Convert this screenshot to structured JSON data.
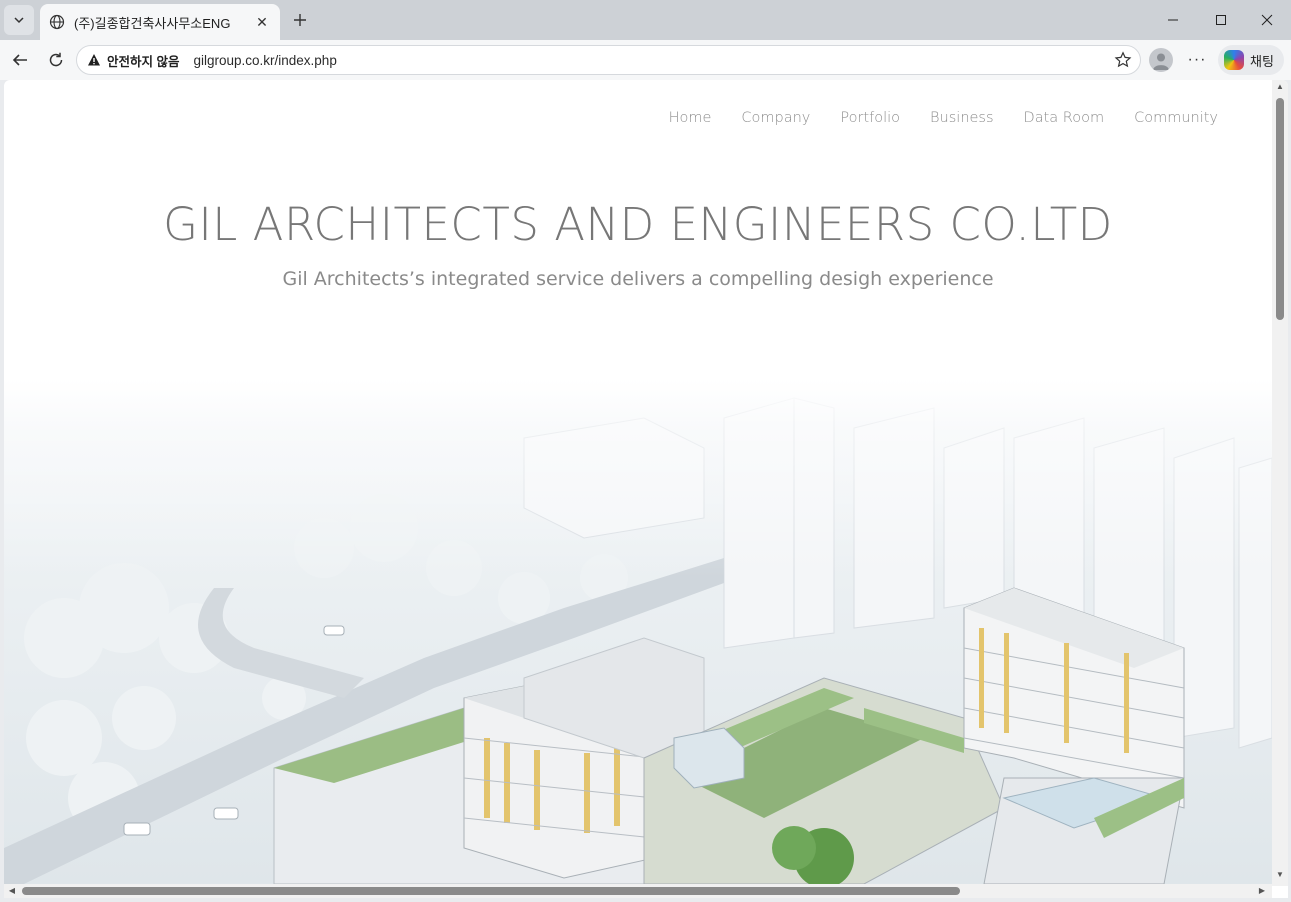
{
  "browser": {
    "tab_title": "(주)길종합건축사사무소ENG",
    "security_label": "안전하지 않음",
    "url": "gilgroup.co.kr/index.php",
    "copilot_label": "채팅"
  },
  "site": {
    "nav": [
      "Home",
      "Company",
      "Portfolio",
      "Business",
      "Data Room",
      "Community"
    ],
    "title": "GIL ARCHITECTS AND ENGINEERS CO.LTD",
    "subtitle": "Gil Architects’s integrated service delivers a compelling desigh experience"
  },
  "colors": {
    "text_gray": "#777777",
    "nav_gray": "#8e8e8e",
    "roof_green": "#8fb27a",
    "facade_yellow": "#e5c36a"
  }
}
